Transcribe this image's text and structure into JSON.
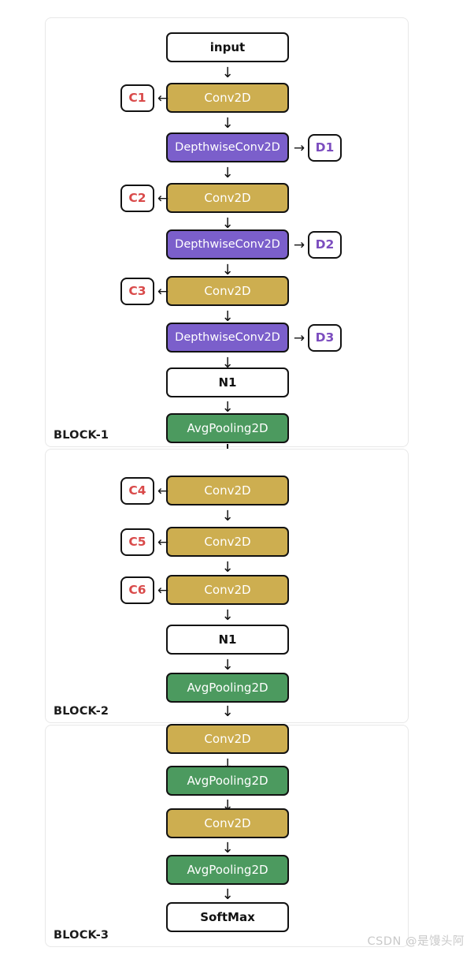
{
  "diagram": {
    "title": "CNN architecture block diagram",
    "colors": {
      "conv": "#cdae50",
      "depthwise": "#7b5fcb",
      "pooling": "#4c9a5f",
      "plain": "#ffffff",
      "border": "#121212",
      "tag_c_text": "#d94a4a",
      "tag_d_text": "#7c4dbf",
      "block_border": "#e8e8e8",
      "watermark": "#c9c9c9"
    },
    "glyphs": {
      "arrow_down": "↓",
      "arrow_left": "←",
      "arrow_right": "→"
    }
  },
  "blocks": [
    {
      "label": "BLOCK-1",
      "nodes": [
        {
          "text": "input",
          "kind": "plain"
        },
        {
          "text": "Conv2D",
          "kind": "conv",
          "tag": "C1",
          "tag_side": "left"
        },
        {
          "text": "DepthwiseConv2D",
          "kind": "depth",
          "tag": "D1",
          "tag_side": "right"
        },
        {
          "text": "Conv2D",
          "kind": "conv",
          "tag": "C2",
          "tag_side": "left"
        },
        {
          "text": "DepthwiseConv2D",
          "kind": "depth",
          "tag": "D2",
          "tag_side": "right"
        },
        {
          "text": "Conv2D",
          "kind": "conv",
          "tag": "C3",
          "tag_side": "left"
        },
        {
          "text": "DepthwiseConv2D",
          "kind": "depth",
          "tag": "D3",
          "tag_side": "right"
        },
        {
          "text": "N1",
          "kind": "plain"
        },
        {
          "text": "AvgPooling2D",
          "kind": "pool"
        }
      ]
    },
    {
      "label": "BLOCK-2",
      "nodes": [
        {
          "text": "Conv2D",
          "kind": "conv",
          "tag": "C4",
          "tag_side": "left"
        },
        {
          "text": "Conv2D",
          "kind": "conv",
          "tag": "C5",
          "tag_side": "left"
        },
        {
          "text": "Conv2D",
          "kind": "conv",
          "tag": "C6",
          "tag_side": "left"
        },
        {
          "text": "N1",
          "kind": "plain"
        },
        {
          "text": "AvgPooling2D",
          "kind": "pool"
        }
      ]
    },
    {
      "label": "BLOCK-3",
      "nodes": [
        {
          "text": "Conv2D",
          "kind": "conv"
        },
        {
          "text": "AvgPooling2D",
          "kind": "pool"
        },
        {
          "text": "Conv2D",
          "kind": "conv"
        },
        {
          "text": "AvgPooling2D",
          "kind": "pool"
        },
        {
          "text": "SoftMax",
          "kind": "plain"
        }
      ]
    }
  ],
  "watermark": "CSDN @是馒头阿"
}
